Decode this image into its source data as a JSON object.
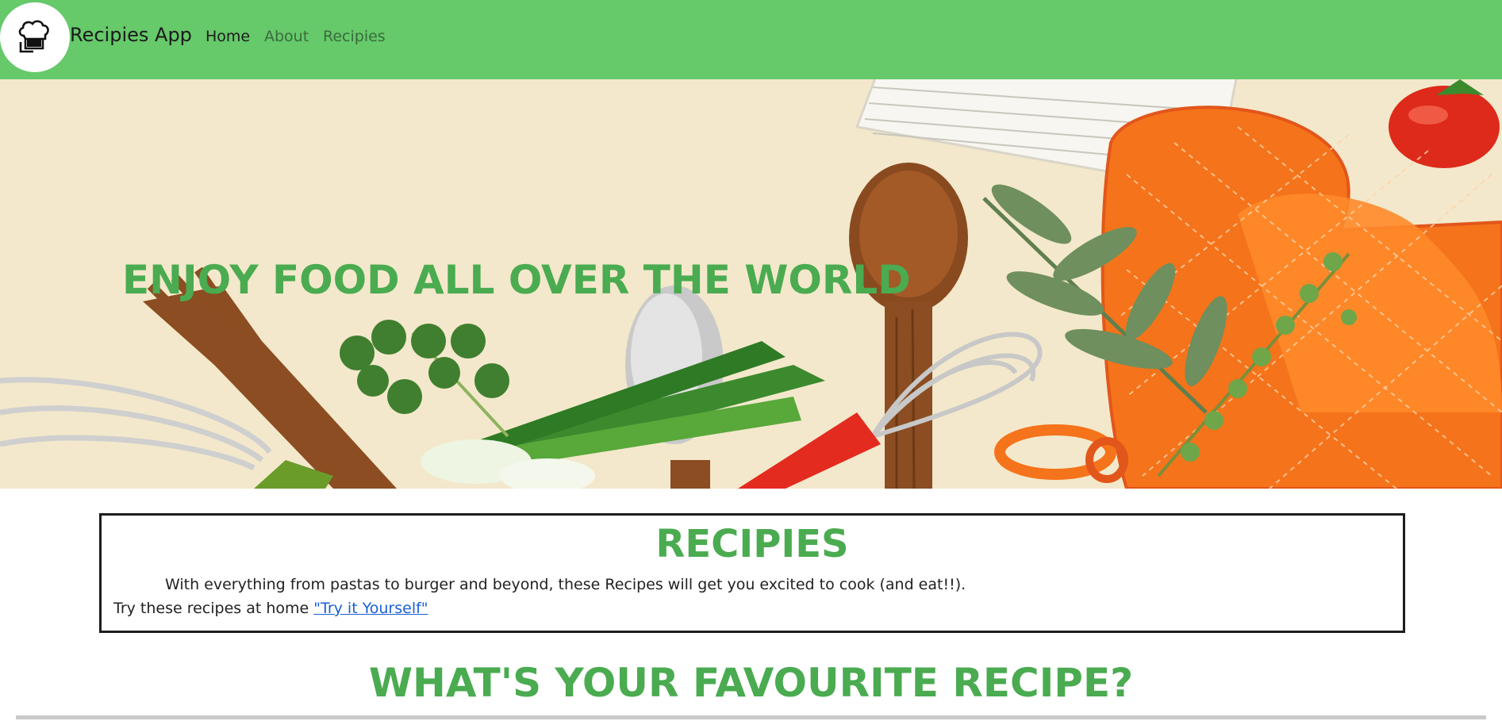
{
  "nav": {
    "brand": "Recipies App",
    "links": [
      {
        "label": "Home",
        "active": true
      },
      {
        "label": "About",
        "active": false
      },
      {
        "label": "Recipies",
        "active": false
      }
    ]
  },
  "hero": {
    "title": "ENJOY FOOD ALL OVER THE WORLD"
  },
  "recipes": {
    "title": "RECIPIES",
    "description": "With everything from pastas to burger and beyond, these Recipes will get you excited to cook (and eat!!).",
    "try_text": "Try these recipes at home ",
    "try_link": "\"Try it Yourself\""
  },
  "favourite": {
    "title": "WHAT'S YOUR FAVOURITE RECIPE?"
  },
  "colors": {
    "navbar": "#66c96a",
    "accent_green": "#4aab50",
    "link": "#1a5fd6",
    "hero_background": "#f3e8cb"
  },
  "icons": {
    "logo": "chef-hat-icon"
  }
}
